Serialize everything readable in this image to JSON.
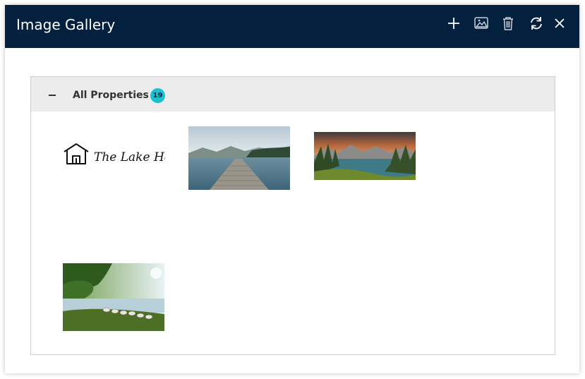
{
  "window": {
    "title": "Image Gallery"
  },
  "toolbar": {
    "icons": [
      "plus-icon",
      "image-icon",
      "trash-icon",
      "refresh-icon",
      "close-icon"
    ]
  },
  "group": {
    "label": "All Properties",
    "count": "19",
    "collapse_icon": "minus-icon",
    "badge_color": "#1ac1d3"
  },
  "gallery": {
    "images": [
      {
        "name": "logo",
        "brand_text": "The Lake House.",
        "subject": "house logo"
      },
      {
        "name": "dock",
        "subject": "wooden dock on a lake"
      },
      {
        "name": "sunset",
        "subject": "mountain lake at sunset"
      },
      {
        "name": "geese",
        "subject": "geese on a lake shore"
      }
    ]
  },
  "colors": {
    "titlebar": "#03203e",
    "header_bg": "#ececec"
  }
}
